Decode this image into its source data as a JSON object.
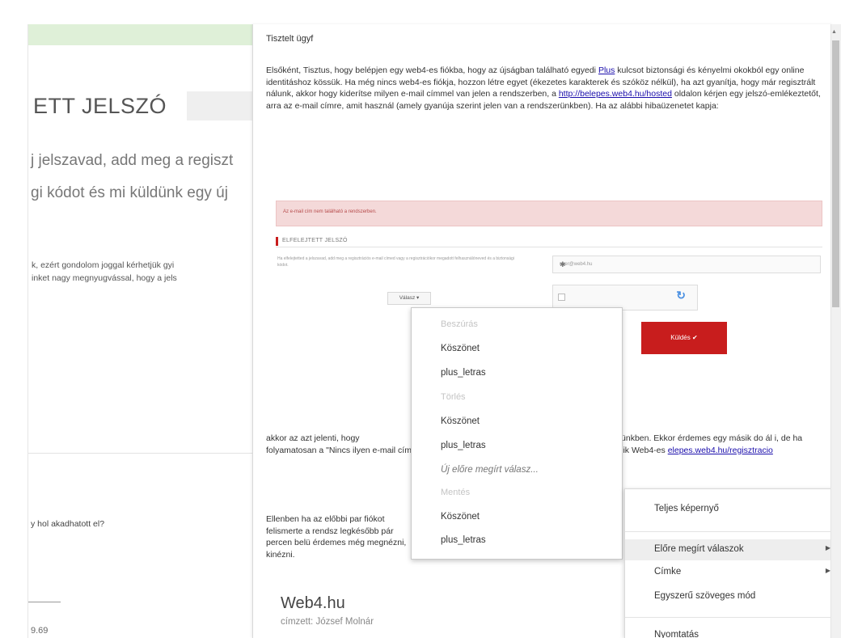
{
  "background_page": {
    "title": "ETT JELSZÓ",
    "line1": "j jelszavad, add meg a regiszt",
    "line2": "gi kódot és mi küldünk egy új",
    "small1": "k, ezért gondolom joggal kérhetjük gyi",
    "small2": "inket nagy megnyugvással, hogy a jels",
    "question": "y hol akadhatott el?",
    "tail": "9.69"
  },
  "email": {
    "greeting": "Tisztelt ügyf",
    "para1_a": "Elsőként, Tisztus, hogy belépjen egy web4-es fiókba, hogy az újságban található egyedi",
    "para1_plus": "Plus",
    "para1_b": "kulcsot biztonsági és kényelmi okokból egy online identitáshoz kössük. Ha még nincs web4-es fiókja, hozzon létre egyet (ékezetes karakterek és szóköz nélkül), ha azt gyanítja, hogy már regisztrált nálunk, akkor hogy kiderítse milyen e-mail címmel van jelen a rendszerben, a",
    "para1_link": "http://belepes.web4.hu/hosted",
    "para1_c": "oldalon kérjen egy jelszó-emlékeztetőt, arra az e-mail címre, amit használ (amely gyanúja szerint jelen van a rendszerünkben). Ha az alábbi hibaüzenetet kapja:",
    "shot": {
      "alert": "Az e-mail cím nem található a rendszerben.",
      "header": "ELFELEJTETT JELSZÓ",
      "text": "Ha elfelejtetted a jelszavad, add meg a regisztrációs e-mail címed vagy a regisztrációkor megadott felhasználóneved és a biztonsági kódot.",
      "input": "user@web4.hu",
      "dropdown_btn": "Válasz ▾",
      "send": "Küldés ✔"
    },
    "para2_a": "akkor az azt jelenti, hogy",
    "para2_b": "a rendszerünkben. Ekkor érdemes egy másik do ál",
    "para2_c": "i, de ha folyamatosan a \"Nincs ilyen e-mail című felhaszn",
    "para2_d": "akkor az azt jelenti, hogy még nem rendelkezik Web4-es",
    "para2_link": "elepes.web4.hu/regisztracio",
    "para3": "Ellenben ha az előbbi par fiókot felismerte a rendsz legkésőbb pár percen belü érdemes még megnézni, kinézni.",
    "sender": "Web4.hu",
    "to": "címzett: József Molnár"
  },
  "dropdown": {
    "header_insert": "Beszúrás",
    "insert_1": "Köszönet",
    "insert_2": "plus_letras",
    "header_delete": "Törlés",
    "delete_1": "Köszönet",
    "delete_2": "plus_letras",
    "new_canned": "Új előre megírt válasz...",
    "header_save": "Mentés",
    "save_1": "Köszönet",
    "save_2": "plus_letras"
  },
  "menu": {
    "fullscreen": "Teljes képernyő",
    "canned": "Előre megírt válaszok",
    "labels": "Címke",
    "plain_text": "Egyszerű szöveges mód",
    "print": "Nyomtatás"
  }
}
